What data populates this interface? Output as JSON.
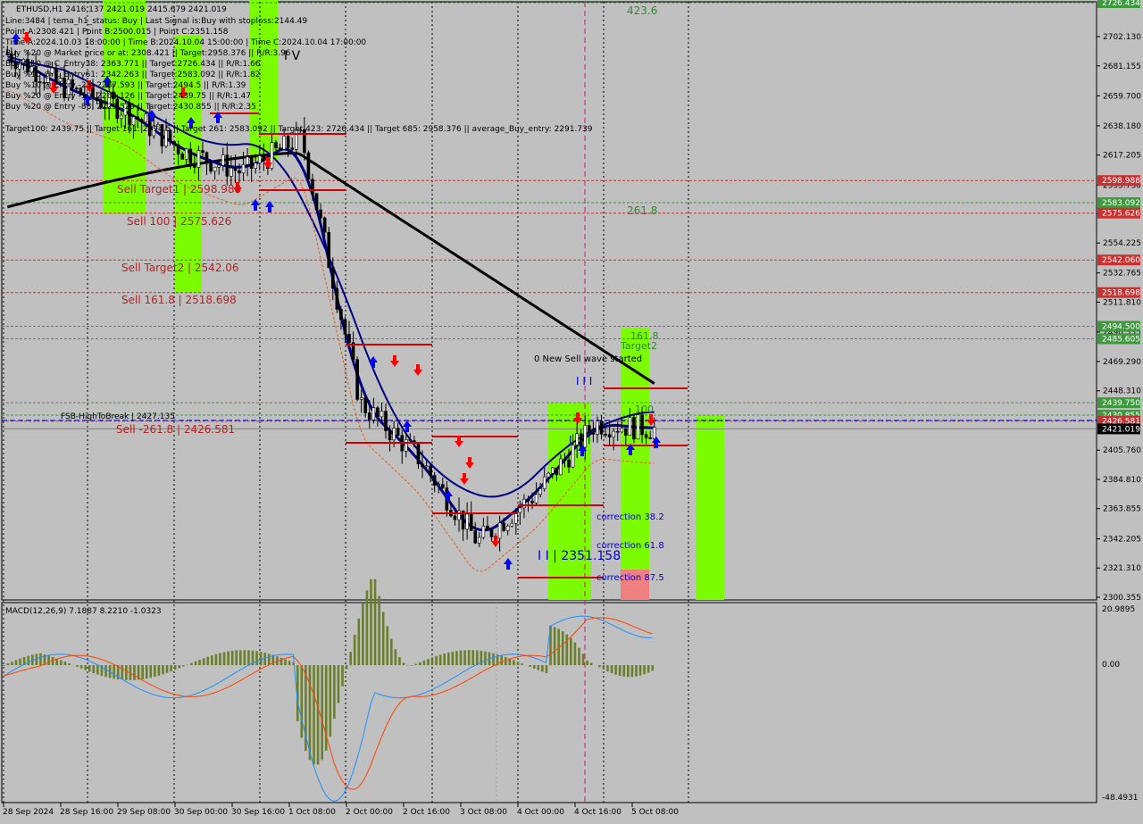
{
  "header": {
    "symbol_line": "ETHUSD,H1  2416.137 2421.019 2415.679 2421.019",
    "info_lines": [
      "Line:3484 | tema_h1_status: Buy | Last Signal is:Buy with stoploss:2144.49",
      "Point A:2308.421 | Point B:2500.015 | Point C:2351.158",
      "Time A:2024.10.03 18:00:00 | Time B:2024.10.04 15:00:00 | Time C:2024.10.04 17:00:00",
      "Buy %20 @ Market price or at: 2308.421 || Target:2958.376 || R/R:3.96",
      "Buy %10 @ C_Entry38: 2363.771 || Target:2726.434 || R/R:1.66",
      "Buy %10 @ C_Entry61: 2342.263 || Target:2583.092 || R/R:1.82",
      "Buy %10 @ Entry -23: 2287.593 || Target:2494.5 || R/R:1.39",
      "Buy %20 @ Entry -50: 2264.126 || Target:2439.75 || R/R:1.47",
      "Buy %20 @ Entry -88: 2229.529 || Target:2430.855 || R/R:2.35",
      "Target100: 2439.75 || Target 161: 2494.5 || Target 261: 2583.092 || Target 423: 2726.434 || Target 685: 2958.376 || average_Buy_entry: 2291.739"
    ]
  },
  "annotations": {
    "roman_iv": "I V",
    "fib_423": "423.6",
    "fib_261": "261.8",
    "fib_161": "161.8",
    "target2": "Target2",
    "fib_100": "100",
    "new_sell_wave": "0 New Sell wave started",
    "roman_iii": "I I I",
    "roman_ii": "I I",
    "roman_i": "I",
    "point_c_label": "I I | 2351.158",
    "corr_382": "correction 38.2",
    "corr_618": "correction 61.8",
    "corr_875": "correction 87.5",
    "sell_target1": "Sell Target1 | 2598.988",
    "sell_100": "Sell 100 | 2575.626",
    "sell_target2": "Sell Target2 | 2542.06",
    "sell_1618": "Sell 161.8 | 2518.698",
    "fsb_high": "FSB-HighToBreak | 2427.135",
    "sell_2618": "Sell -261.8 | 2426.581"
  },
  "macd": {
    "label": "MACD(12,26,9) 7.1887 8.2210 -1.0323",
    "axis_top": "20.9895",
    "axis_zero": "0.00",
    "axis_bottom": "-48.4931"
  },
  "price_axis": {
    "ticks": [
      "2702.130",
      "2681.155",
      "2659.700",
      "2638.180",
      "2617.205",
      "2595.730",
      "2575.200",
      "2554.225",
      "2532.765",
      "2511.810",
      "2490.335",
      "2469.290",
      "2448.310",
      "2426.855",
      "2405.760",
      "2384.810",
      "2363.855",
      "2342.205",
      "2321.310",
      "2300.355"
    ],
    "badges": [
      {
        "text": "2726.434",
        "color": "#3f9a3f"
      },
      {
        "text": "2598.988",
        "color": "#c83232"
      },
      {
        "text": "2583.092",
        "color": "#3f9a3f"
      },
      {
        "text": "2575.626",
        "color": "#c83232"
      },
      {
        "text": "2542.060",
        "color": "#c83232"
      },
      {
        "text": "2518.698",
        "color": "#c83232"
      },
      {
        "text": "2494.500",
        "color": "#3f9a3f"
      },
      {
        "text": "2485.605",
        "color": "#3f9a3f"
      },
      {
        "text": "2439.750",
        "color": "#3f9a3f"
      },
      {
        "text": "2430.855",
        "color": "#3f9a3f"
      },
      {
        "text": "2426.581",
        "color": "#c83232"
      },
      {
        "text": "2421.019",
        "color": "#000000"
      }
    ]
  },
  "time_axis": [
    "28 Sep 2024",
    "28 Sep 16:00",
    "29 Sep 08:00",
    "30 Sep 00:00",
    "30 Sep 16:00",
    "1 Oct 08:00",
    "2 Oct 00:00",
    "2 Oct 16:00",
    "3 Oct 08:00",
    "4 Oct 00:00",
    "4 Oct 16:00",
    "5 Oct 08:00"
  ],
  "colors": {
    "background": "#c0c0c0",
    "green_zone": "#7cfc00",
    "sell_red": "#c83232",
    "buy_blue": "#0000ff",
    "ma_black": "#000000",
    "ma_navy": "#000080",
    "macd_hist": "#6b7f2a",
    "macd_line": "#1e90ff",
    "signal_line": "#ff4500"
  },
  "chart_data": {
    "type": "candlestick",
    "title": "ETHUSD,H1",
    "ylim": [
      2300.355,
      2726.434
    ],
    "x": [
      "28 Sep 2024",
      "28 Sep 16:00",
      "29 Sep 08:00",
      "30 Sep 00:00",
      "30 Sep 16:00",
      "1 Oct 08:00",
      "2 Oct 00:00",
      "2 Oct 16:00",
      "3 Oct 08:00",
      "4 Oct 00:00",
      "4 Oct 16:00",
      "5 Oct 08:00"
    ],
    "series": [
      {
        "name": "Close",
        "values": [
          2690,
          2665,
          2650,
          2620,
          2605,
          2630,
          2440,
          2400,
          2340,
          2375,
          2425,
          2421
        ]
      }
    ],
    "last": {
      "open": 2416.137,
      "high": 2421.019,
      "low": 2415.679,
      "close": 2421.019
    }
  }
}
